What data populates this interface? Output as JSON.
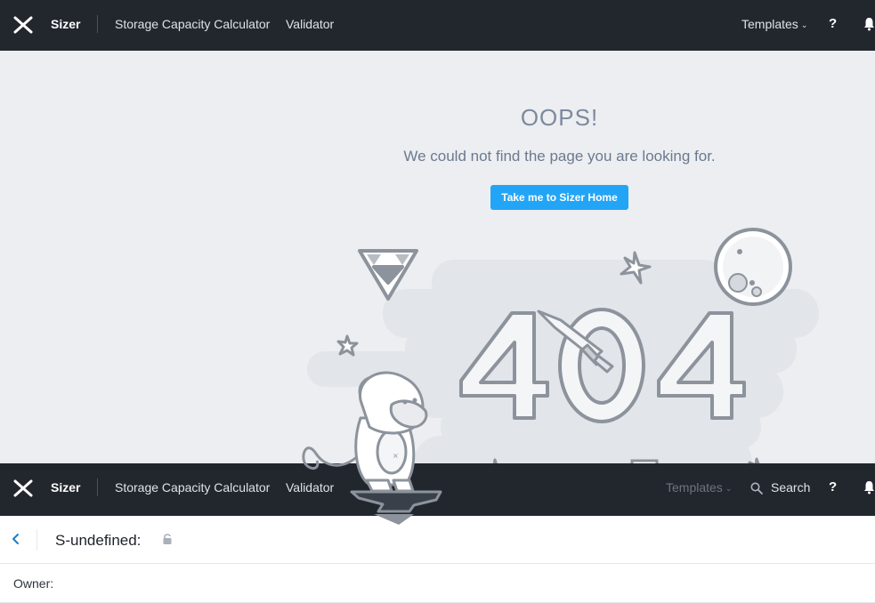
{
  "nav": {
    "brand": "Sizer",
    "link1": "Storage Capacity Calculator",
    "link2": "Validator",
    "templates": "Templates",
    "templates_chevron": "chevron-down-icon",
    "help": "?",
    "search": "Search"
  },
  "error": {
    "title": "OOPS!",
    "message": "We could not find the page you are looking for.",
    "button": "Take me to Sizer Home",
    "illustration_text": "404"
  },
  "scenario": {
    "name": "S-undefined:",
    "owner_label": "Owner:"
  },
  "icons": {
    "logo": "nutanix-x-logo-icon",
    "bell": "bell-icon",
    "search": "search-icon",
    "back": "chevron-left-icon",
    "lock": "lock-icon"
  },
  "colors": {
    "topbar": "#22272e",
    "page_bg": "#eceef1",
    "accent": "#22a5f7",
    "heading": "#7c8a9e",
    "back_accent": "#1a7fc4"
  }
}
